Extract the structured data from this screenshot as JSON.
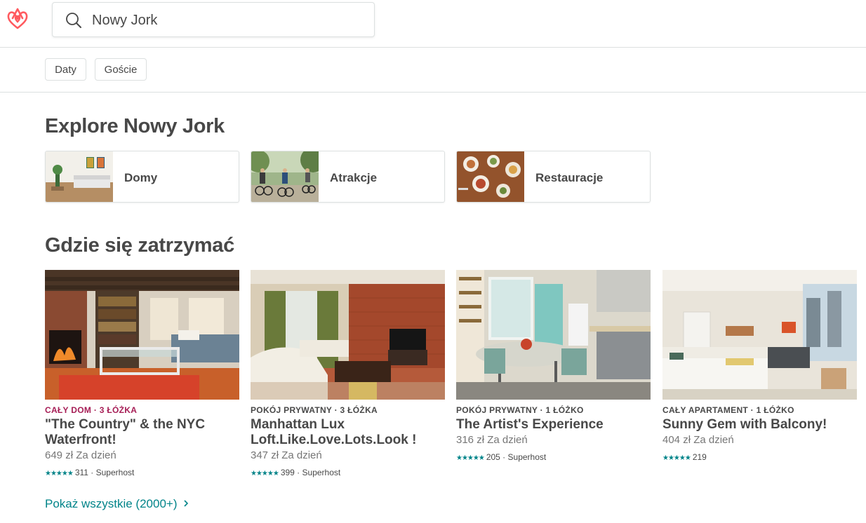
{
  "colors": {
    "brand": "#FF5A5F",
    "accent": "#008489",
    "text": "#484848",
    "muted": "#767676",
    "kicker_red": "#A61D55",
    "kicker_dark": "#484848"
  },
  "header": {
    "logo_icon": "airbnb-logo-icon",
    "search": {
      "icon": "search-icon",
      "value": "Nowy Jork"
    }
  },
  "filters": {
    "dates": "Daty",
    "guests": "Goście"
  },
  "explore": {
    "title": "Explore Nowy Jork",
    "categories": [
      {
        "label": "Domy"
      },
      {
        "label": "Atrakcje"
      },
      {
        "label": "Restauracje"
      }
    ]
  },
  "stay": {
    "title": "Gdzie się zatrzymać",
    "listings": [
      {
        "kicker": "CAŁY DOM · 3 ŁÓŻKA",
        "name": "\"The Country\" & the NYC Waterfront!",
        "price": "649 zł  Za dzień",
        "stars": "★★★★★",
        "rating": 4.5,
        "reviews": "311 · Superhost"
      },
      {
        "kicker": "POKÓJ PRYWATNY · 3 ŁÓŻKA",
        "name": "Manhattan Lux Loft.Like.Love.Lots.Look !",
        "price": "347 zł  Za dzień",
        "stars": "★★★★★",
        "rating": 5,
        "reviews": "399 · Superhost"
      },
      {
        "kicker": "POKÓJ PRYWATNY · 1 ŁÓŻKO",
        "name": "The Artist's Experience",
        "price": "316 zł  Za dzień",
        "stars": "★★★★★",
        "rating": 5,
        "reviews": "205 · Superhost"
      },
      {
        "kicker": "CAŁY APARTAMENT · 1 ŁÓŻKO",
        "name": "Sunny Gem with Balcony!",
        "price": "404 zł  Za dzień",
        "stars": "★★★★★",
        "rating": 4.5,
        "reviews": "219"
      }
    ],
    "show_all": "Pokaż wszystkie (2000+)",
    "show_all_icon": "chevron-right-icon"
  }
}
